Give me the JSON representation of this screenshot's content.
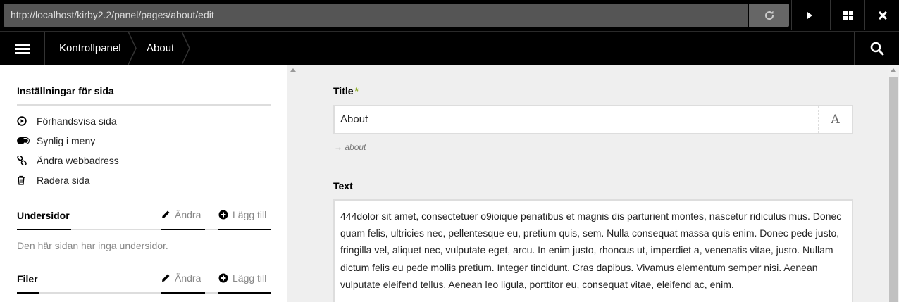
{
  "browser": {
    "url": "http://localhost/kirby2.2/panel/pages/about/edit"
  },
  "topbar": {
    "breadcrumbs": [
      "Kontrollpanel",
      "About"
    ]
  },
  "sidebar": {
    "settings_title": "Inställningar för sida",
    "actions": [
      {
        "label": "Förhandsvisa sida",
        "icon": "play-circle-icon"
      },
      {
        "label": "Synlig i meny",
        "icon": "toggle-on-icon"
      },
      {
        "label": "Ändra webbadress",
        "icon": "link-icon"
      },
      {
        "label": "Radera sida",
        "icon": "trash-icon"
      }
    ],
    "subpages": {
      "title": "Undersidor",
      "edit_label": "Ändra",
      "add_label": "Lägg till",
      "empty": "Den här sidan har inga undersidor."
    },
    "files": {
      "title": "Filer",
      "edit_label": "Ändra",
      "add_label": "Lägg till"
    }
  },
  "form": {
    "title_label": "Title",
    "required_mark": "*",
    "title_value": "About",
    "title_type_glyph": "A",
    "slug": "about",
    "text_label": "Text",
    "text_value": "444dolor sit amet, consectetuer o9ioique penatibus et magnis dis parturient montes, nascetur ridiculus mus. Donec quam felis, ultricies nec, pellentesque eu, pretium quis, sem. Nulla consequat massa quis enim. Donec pede justo, fringilla vel, aliquet nec, vulputate eget, arcu. In enim justo, rhoncus ut, imperdiet a, venenatis vitae, justo. Nullam dictum felis eu pede mollis pretium. Integer tincidunt. Cras dapibus. Vivamus elementum semper nisi. Aenean vulputate eleifend tellus. Aenean leo ligula, porttitor eu, consequat vitae, eleifend ac, enim."
  },
  "colors": {
    "accent_required": "#8dae28",
    "topbar_bg": "#000000"
  }
}
